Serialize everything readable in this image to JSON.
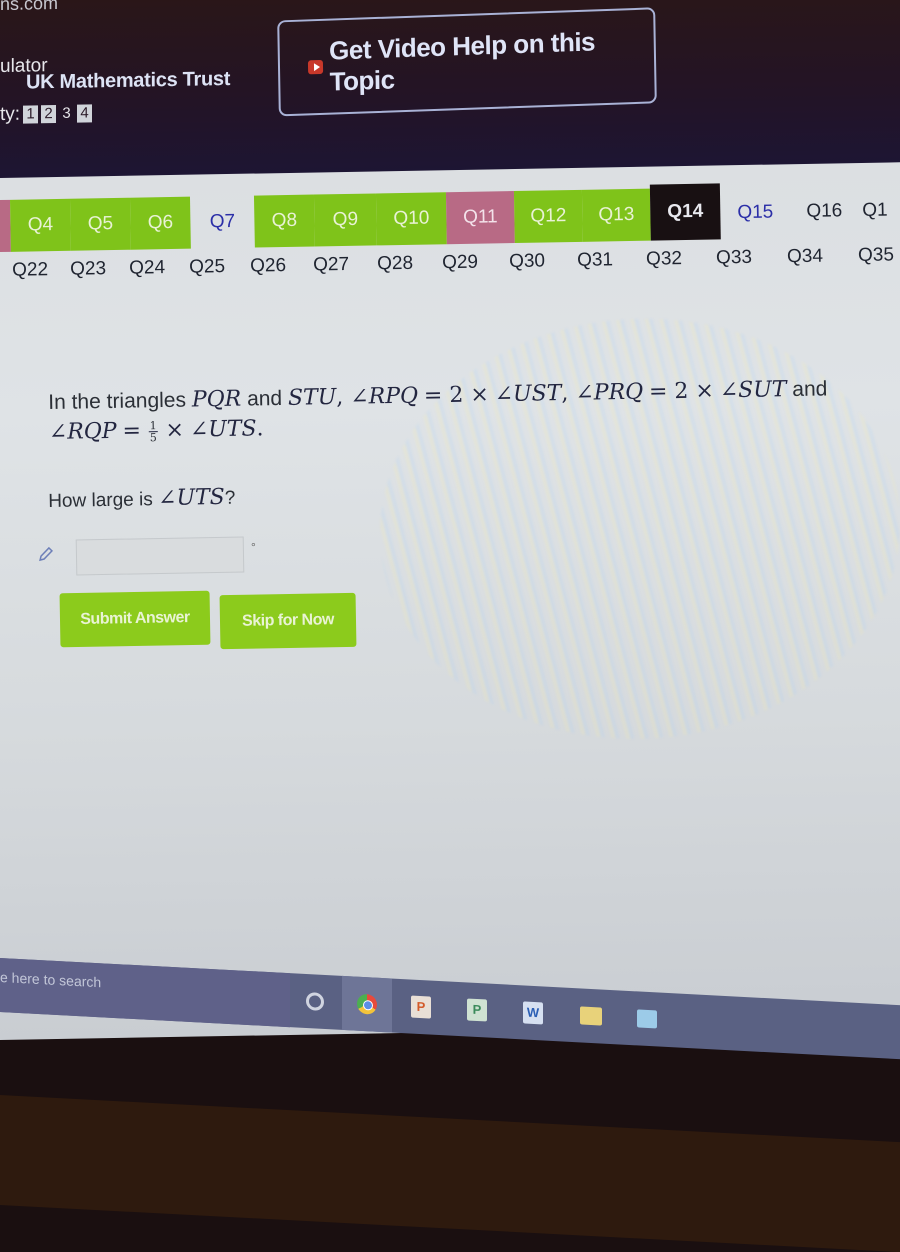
{
  "header": {
    "url_fragment": "ns.com",
    "calculator_label": "ulator",
    "source": "UK Mathematics Trust",
    "difficulty_label": "ty:",
    "difficulty_levels": [
      {
        "label": "1",
        "boxed": true
      },
      {
        "label": "2",
        "boxed": true
      },
      {
        "label": "3",
        "boxed": false
      },
      {
        "label": "4",
        "boxed": true
      }
    ],
    "video_help_button": "Get Video Help on this Topic"
  },
  "question_nav": {
    "row1": [
      {
        "label": "Q4",
        "status": "correct"
      },
      {
        "label": "Q5",
        "status": "correct"
      },
      {
        "label": "Q6",
        "status": "correct"
      },
      {
        "label": "Q7",
        "status": "visited"
      },
      {
        "label": "Q8",
        "status": "correct"
      },
      {
        "label": "Q9",
        "status": "correct"
      },
      {
        "label": "Q10",
        "status": "correct"
      },
      {
        "label": "Q11",
        "status": "wrong"
      },
      {
        "label": "Q12",
        "status": "correct"
      },
      {
        "label": "Q13",
        "status": "correct"
      },
      {
        "label": "Q14",
        "status": "current"
      },
      {
        "label": "Q15",
        "status": "visited"
      },
      {
        "label": "Q16",
        "status": "unvisited"
      },
      {
        "label": "Q1",
        "status": "unvisited"
      }
    ],
    "row2": [
      "Q22",
      "Q23",
      "Q24",
      "Q25",
      "Q26",
      "Q27",
      "Q28",
      "Q29",
      "Q30",
      "Q31",
      "Q32",
      "Q33",
      "Q34",
      "Q35"
    ],
    "colors": {
      "correct": "#7fc31a",
      "wrong": "#b86a85",
      "current": "#181012",
      "visited": "#2b2fa8"
    }
  },
  "question": {
    "intro": "In the triangles",
    "tri1": "PQR",
    "and": "and",
    "tri2": "STU",
    "cond1_lhs": "∠RPQ",
    "eq": "= 2 ×",
    "cond1_rhs": "∠UST",
    "cond2_lhs": "∠PRQ",
    "cond2_rhs": "∠SUT",
    "and2": "and",
    "cond3_lhs": "∠RQP",
    "eq3": "=",
    "frac_num": "1",
    "frac_den": "5",
    "times": "×",
    "cond3_rhs": "∠UTS",
    "ask_text": "How large is",
    "ask_angle": "∠UTS",
    "ask_end": "?"
  },
  "answer": {
    "value": "",
    "placeholder": "",
    "unit": "°"
  },
  "buttons": {
    "submit": "Submit Answer",
    "skip": "Skip for Now"
  },
  "taskbar": {
    "search_placeholder": "e here to search",
    "apps": [
      "cortana",
      "chrome",
      "powerpoint",
      "publisher",
      "word",
      "file-explorer",
      "other-app"
    ],
    "word_letter": "W",
    "ppt_letter": "P",
    "pub_letter": "P"
  }
}
